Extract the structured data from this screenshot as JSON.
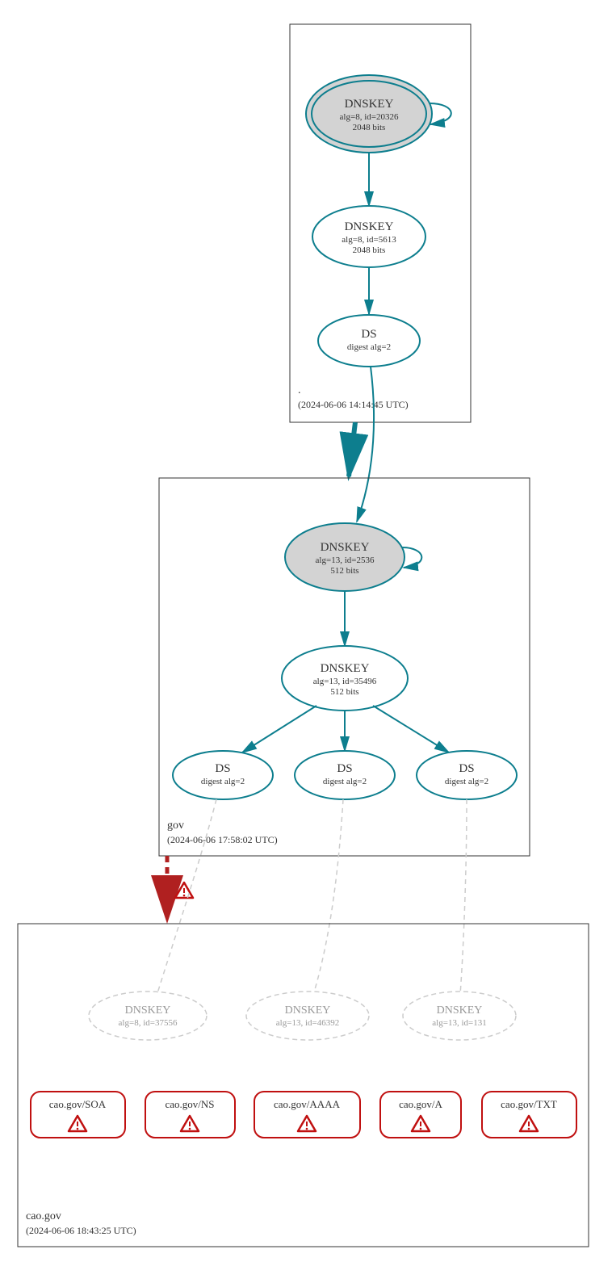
{
  "zones": {
    "root": {
      "name": ".",
      "timestamp": "(2024-06-06 14:14:45 UTC)"
    },
    "gov": {
      "name": "gov",
      "timestamp": "(2024-06-06 17:58:02 UTC)"
    },
    "caogov": {
      "name": "cao.gov",
      "timestamp": "(2024-06-06 18:43:25 UTC)"
    }
  },
  "root_ksk": {
    "title": "DNSKEY",
    "alg": "alg=8, id=20326",
    "bits": "2048 bits"
  },
  "root_zsk": {
    "title": "DNSKEY",
    "alg": "alg=8, id=5613",
    "bits": "2048 bits"
  },
  "root_ds": {
    "title": "DS",
    "digest": "digest alg=2"
  },
  "gov_ksk": {
    "title": "DNSKEY",
    "alg": "alg=13, id=2536",
    "bits": "512 bits"
  },
  "gov_zsk": {
    "title": "DNSKEY",
    "alg": "alg=13, id=35496",
    "bits": "512 bits"
  },
  "gov_ds1": {
    "title": "DS",
    "digest": "digest alg=2"
  },
  "gov_ds2": {
    "title": "DS",
    "digest": "digest alg=2"
  },
  "gov_ds3": {
    "title": "DS",
    "digest": "digest alg=2"
  },
  "cao_key1": {
    "title": "DNSKEY",
    "alg": "alg=8, id=37556"
  },
  "cao_key2": {
    "title": "DNSKEY",
    "alg": "alg=13, id=46392"
  },
  "cao_key3": {
    "title": "DNSKEY",
    "alg": "alg=13, id=131"
  },
  "records": {
    "soa": "cao.gov/SOA",
    "ns": "cao.gov/NS",
    "aaaa": "cao.gov/AAAA",
    "a": "cao.gov/A",
    "txt": "cao.gov/TXT"
  }
}
